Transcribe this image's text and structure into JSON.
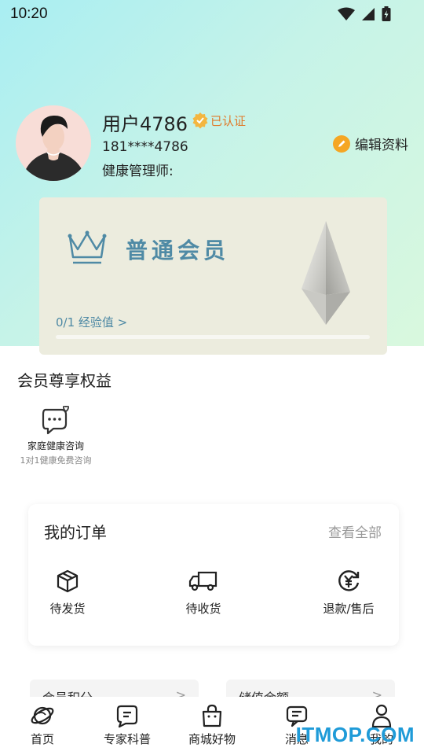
{
  "status_bar": {
    "time": "10:20"
  },
  "profile": {
    "name": "用户4786",
    "verified_label": "已认证",
    "phone": "181****4786",
    "health_manager": "健康管理师:",
    "edit_label": "编辑资料"
  },
  "member_card": {
    "level": "普通会员",
    "exp_link": "0/1 经验值 >",
    "exp_progress": 0
  },
  "benefits": {
    "title": "会员尊享权益",
    "items": [
      {
        "label": "家庭健康咨询",
        "sub": "1对1健康免费咨询",
        "icon": "chat-heart-icon"
      }
    ]
  },
  "orders": {
    "title": "我的订单",
    "view_all": "查看全部",
    "items": [
      {
        "label": "待发货",
        "icon": "package-icon"
      },
      {
        "label": "待收货",
        "icon": "truck-icon"
      },
      {
        "label": "退款/售后",
        "icon": "refund-icon"
      }
    ]
  },
  "mini_cards": [
    {
      "label": "会员积分",
      "arrow": ">"
    },
    {
      "label": "储值余额",
      "arrow": ">"
    }
  ],
  "tabbar": {
    "items": [
      {
        "label": "首页",
        "icon": "planet-icon"
      },
      {
        "label": "专家科普",
        "icon": "doc-icon"
      },
      {
        "label": "商城好物",
        "icon": "bag-icon"
      },
      {
        "label": "消息",
        "icon": "message-icon"
      },
      {
        "label": "我的",
        "icon": "person-icon"
      }
    ]
  },
  "watermark": "ITMOP.COM",
  "colors": {
    "accent_blue": "#4f8aa5",
    "verified_orange": "#e07a2a",
    "edit_orange": "#f5a623",
    "watermark_blue": "#1f9bd8"
  }
}
